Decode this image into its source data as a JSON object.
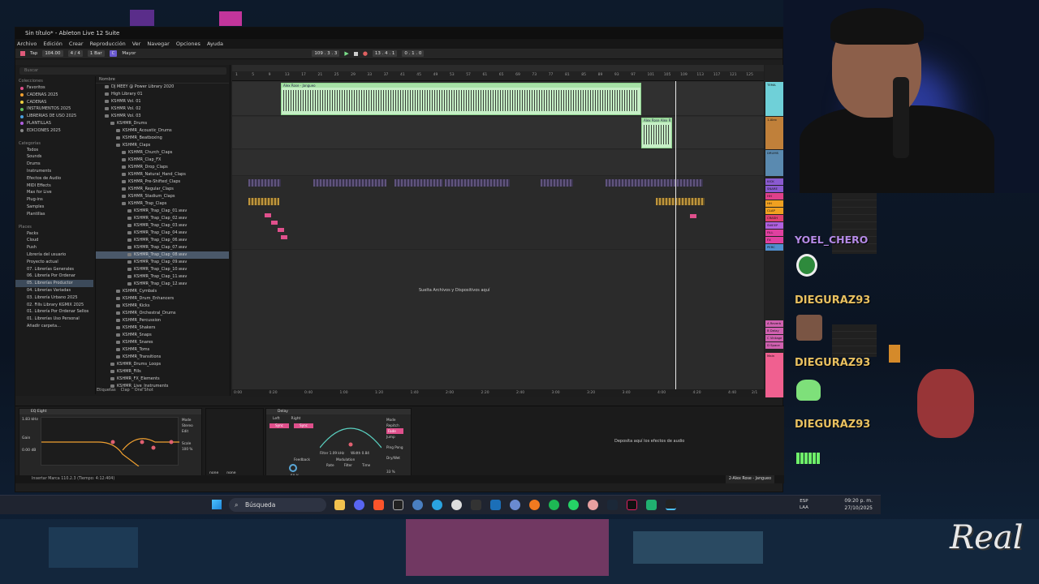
{
  "window": {
    "title": "Sin título* - Ableton Live 12 Suite"
  },
  "menu": [
    "Archivo",
    "Edición",
    "Crear",
    "Reproducción",
    "Ver",
    "Navegar",
    "Opciones",
    "Ayuda"
  ],
  "control_bar": {
    "tap": "Tap",
    "bpm": "104.00",
    "signature": "4 / 4",
    "quantize": "1 Bar",
    "key": "C",
    "scale": "Mayor",
    "position": "109 . 3 . 3",
    "loop_start": "13 . 4 . 1",
    "loop_len": "0 . 1 . 0"
  },
  "browser": {
    "search_placeholder": "Buscar",
    "collections_header": "Colecciones",
    "collections": [
      {
        "label": "Favoritos",
        "color": "#e0508c"
      },
      {
        "label": "CADENAS 2025",
        "color": "#f0a030"
      },
      {
        "label": "CADENAS",
        "color": "#f0d040"
      },
      {
        "label": "INSTRUMENTOS 2025",
        "color": "#60c060"
      },
      {
        "label": "LIBRERIAS DE USO 2025",
        "color": "#4aa0e0"
      },
      {
        "label": "PLANTILLAS",
        "color": "#b060e0"
      },
      {
        "label": "EDICIONES 2025",
        "color": "#888888"
      }
    ],
    "categories_header": "Categorías",
    "categories": [
      "Todos",
      "Sounds",
      "Drums",
      "Instruments",
      "Efectos de Audio",
      "MIDI Effects",
      "Max for Live",
      "Plug-ins",
      "Samples",
      "Plantillas"
    ],
    "places_header": "Places",
    "places": [
      "Packs",
      "Cloud",
      "Push",
      "Librería del usuario",
      "Proyecto actual",
      "07. Librerías Generales",
      "06. Librería Por Ordenar",
      "05. Librerías Productor",
      "04. Librerías Variadas",
      "03. Librería Urbano 2025",
      "02. Fills Library KGMIX 2025",
      "01. Librería Por Ordenar Sellos",
      "01. Librerías Uso Personal",
      "Añadir carpeta…"
    ],
    "selected_place_index": 7,
    "list_header": "Nombre",
    "list": [
      {
        "label": "DJ MEEY @ Power Library 2020",
        "indent": 1
      },
      {
        "label": "High Library 01",
        "indent": 1
      },
      {
        "label": "KSHMR Vol. 01",
        "indent": 1
      },
      {
        "label": "KSHMR Vol. 02",
        "indent": 1
      },
      {
        "label": "KSHMR Vol. 03",
        "indent": 1
      },
      {
        "label": "KSHMR_Drums",
        "indent": 2
      },
      {
        "label": "KSHMR_Acoustic_Drums",
        "indent": 3
      },
      {
        "label": "KSHMR_Beatboxing",
        "indent": 3
      },
      {
        "label": "KSHMR_Claps",
        "indent": 3
      },
      {
        "label": "KSHMR_Church_Claps",
        "indent": 4
      },
      {
        "label": "KSHMR_Clap_FX",
        "indent": 4
      },
      {
        "label": "KSHMR_Drop_Claps",
        "indent": 4
      },
      {
        "label": "KSHMR_Natural_Hand_Claps",
        "indent": 4
      },
      {
        "label": "KSHMR_Pre-Shifted_Claps",
        "indent": 4
      },
      {
        "label": "KSHMR_Regular_Claps",
        "indent": 4
      },
      {
        "label": "KSHMR_Stadium_Claps",
        "indent": 4
      },
      {
        "label": "KSHMR_Trap_Claps",
        "indent": 4
      },
      {
        "label": "KSHMR_Trap_Clap_01.wav",
        "indent": 5
      },
      {
        "label": "KSHMR_Trap_Clap_02.wav",
        "indent": 5
      },
      {
        "label": "KSHMR_Trap_Clap_03.wav",
        "indent": 5
      },
      {
        "label": "KSHMR_Trap_Clap_04.wav",
        "indent": 5
      },
      {
        "label": "KSHMR_Trap_Clap_06.wav",
        "indent": 5
      },
      {
        "label": "KSHMR_Trap_Clap_07.wav",
        "indent": 5
      },
      {
        "label": "KSHMR_Trap_Clap_08.wav",
        "indent": 5
      },
      {
        "label": "KSHMR_Trap_Clap_09.wav",
        "indent": 5
      },
      {
        "label": "KSHMR_Trap_Clap_10.wav",
        "indent": 5
      },
      {
        "label": "KSHMR_Trap_Clap_11.wav",
        "indent": 5
      },
      {
        "label": "KSHMR_Trap_Clap_12.wav",
        "indent": 5
      },
      {
        "label": "KSHMR_Cymbals",
        "indent": 3
      },
      {
        "label": "KSHMR_Drum_Enhancers",
        "indent": 3
      },
      {
        "label": "KSHMR_Kicks",
        "indent": 3
      },
      {
        "label": "KSHMR_Orchestral_Drums",
        "indent": 3
      },
      {
        "label": "KSHMR_Percussion",
        "indent": 3
      },
      {
        "label": "KSHMR_Shakers",
        "indent": 3
      },
      {
        "label": "KSHMR_Snaps",
        "indent": 3
      },
      {
        "label": "KSHMR_Snares",
        "indent": 3
      },
      {
        "label": "KSHMR_Toms",
        "indent": 3
      },
      {
        "label": "KSHMR_Transitions",
        "indent": 3
      },
      {
        "label": "KSHMR_Drums_Loops",
        "indent": 2
      },
      {
        "label": "KSHMR_Fills",
        "indent": 2
      },
      {
        "label": "KSHMR_FX_Elements",
        "indent": 2
      },
      {
        "label": "KSHMR_Live_Instruments",
        "indent": 2
      }
    ],
    "selected_list_index": 23,
    "tags_label": "Etiquetas",
    "tags": [
      "Clap",
      "One Shot"
    ]
  },
  "arrangement": {
    "ruler": [
      "1",
      "5",
      "9",
      "13",
      "17",
      "21",
      "25",
      "29",
      "33",
      "37",
      "41",
      "45",
      "49",
      "53",
      "57",
      "61",
      "65",
      "69",
      "73",
      "77",
      "81",
      "85",
      "89",
      "93",
      "97",
      "101",
      "105",
      "109",
      "113",
      "117",
      "121",
      "125"
    ],
    "clip_main": "Alex Rose - Jangueo",
    "clip_secondary": "Alex Rose Alex R",
    "drop_hint": "Suelta Archivos y Dispositivos aquí",
    "time_marks": [
      "0:00",
      "0:20",
      "0:40",
      "1:00",
      "1:20",
      "1:40",
      "2:00",
      "2:20",
      "2:40",
      "3:00",
      "3:20",
      "3:40",
      "4:00",
      "4:20",
      "4:40"
    ],
    "page_indicator": "2/1"
  },
  "tracks": [
    {
      "label": "TEMA",
      "color": "#6fd0d8"
    },
    {
      "label": "1-Alex",
      "color": "#c0803a"
    },
    {
      "label": "DRUMS",
      "color": "#5a8ab0"
    },
    {
      "label": "KICK",
      "color": "#8a5ad0"
    },
    {
      "label": "SNARE",
      "color": "#8a5ad0"
    },
    {
      "label": "HH",
      "color": "#e0408a"
    },
    {
      "label": "HH",
      "color": "#f0a020"
    },
    {
      "label": "CLAP",
      "color": "#f0a020"
    },
    {
      "label": "CRASH",
      "color": "#e04070"
    },
    {
      "label": "SWEEP",
      "color": "#b060e0"
    },
    {
      "label": "FILL",
      "color": "#e040a0"
    },
    {
      "label": "FX",
      "color": "#e040a0"
    },
    {
      "label": "PERC",
      "color": "#5090d0"
    },
    {
      "label": "A Reverb",
      "color": "#d060b0"
    },
    {
      "label": "B Delay",
      "color": "#d060b0"
    },
    {
      "label": "C Vintage",
      "color": "#d060b0"
    },
    {
      "label": "D Space",
      "color": "#d060b0"
    },
    {
      "label": "Main",
      "color": "#f06090"
    }
  ],
  "devices": {
    "eq_title": "EQ Eight",
    "eq_freq": "1.83 kHz",
    "eq_gain": "0.00 dB",
    "eq_mode": "Mode",
    "eq_stereo": "Stereo",
    "eq_edit": "Edit",
    "eq_scale": "Scale",
    "eq_scale_val": "100 %",
    "eq_gain_label": "Gain",
    "delay_title": "Delay",
    "delay_left": "Left",
    "delay_right": "Right",
    "delay_sync": "Sync",
    "delay_mode": "Mode",
    "delay_repitch": "Repitch",
    "delay_fade": "Fade",
    "delay_jump": "Jump",
    "delay_pingpong": "Ping Pong",
    "delay_feedback": "Feedback",
    "delay_feedback_val": "50 %",
    "delay_filter": "Filter 1.09 kHz",
    "delay_width": "Width 0.84",
    "delay_modulation": "Modulation",
    "delay_rate": "Rate",
    "delay_filter_mod": "Filter",
    "delay_time": "Time",
    "delay_drywet": "Dry/Wet",
    "delay_drywet_val": "33 %",
    "fx_drop": "Deposita aquí los efectos de audio",
    "none_a": "none",
    "none_b": "none"
  },
  "status": {
    "text": "Insertar Marca 110.2.3 (Tiempo: 4:12:404)",
    "track": "2-Alex Rose - Jangueo"
  },
  "chat": [
    {
      "name": "YOEL_CHERO",
      "emote": "green-headphone-emote"
    },
    {
      "name": "DIEGURAZ93",
      "emote": "face-emote"
    },
    {
      "name": "DIEGURAZ93",
      "emote": "green-ghost-emote"
    },
    {
      "name": "DIEGURAZ93",
      "emote": "green-pixel-emote"
    }
  ],
  "taskbar": {
    "search": "Búsqueda",
    "lang": "ESP",
    "lang2": "LAA",
    "time": "09:20 p. m.",
    "date": "27/10/2025"
  },
  "watermark": "Real"
}
